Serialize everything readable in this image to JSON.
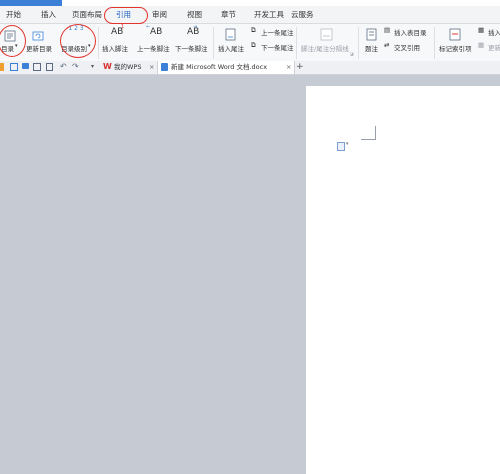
{
  "menu": {
    "items": [
      {
        "label": "开始"
      },
      {
        "label": "插入"
      },
      {
        "label": "页面布局"
      },
      {
        "label": "引用"
      },
      {
        "label": "审阅"
      },
      {
        "label": "视图"
      },
      {
        "label": "章节"
      },
      {
        "label": "开发工具"
      },
      {
        "label": "云服务"
      }
    ],
    "active": "引用"
  },
  "ribbon": {
    "toc": "目录",
    "update_toc": "更新目录",
    "toc_level": "目录级别",
    "insert_footnote": "插入脚注",
    "prev_footnote": "上一条脚注",
    "next_footnote": "下一条脚注",
    "insert_endnote": "插入尾注",
    "prev_endnote": "上一条尾注",
    "next_endnote": "下一条尾注",
    "separator": "脚注/尾注分隔线",
    "caption": "题注",
    "insert_table_toc": "插入表目录",
    "cross_ref": "交叉引用",
    "mark_index": "标记索引项",
    "insert_index": "插入",
    "update_index": "更新",
    "ab_glyph": "AB",
    "sup1": "1",
    "toc_level_glyph": "1 2 3"
  },
  "tabs": {
    "my_wps": "我的WPS",
    "doc": "新建 Microsoft Word 文档.docx",
    "close": "×",
    "add": "+"
  },
  "colors": {
    "annotation_red": "#e2342c",
    "accent_blue": "#3b7fd6",
    "workspace_gray": "#c6cad2"
  }
}
